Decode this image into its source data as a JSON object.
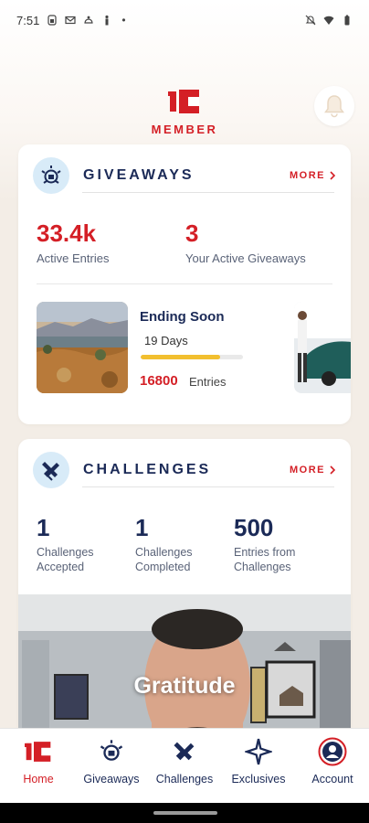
{
  "status_bar": {
    "time": "7:51",
    "dot": "•",
    "icons": [
      "sim-icon",
      "gmail-icon",
      "android-icon",
      "accessibility-icon",
      "mute-icon",
      "wifi-icon",
      "battery-icon"
    ]
  },
  "header": {
    "logo_text": "MEMBER",
    "bell_icon": "bell-icon"
  },
  "giveaways": {
    "title": "GIVEAWAYS",
    "more_label": "MORE",
    "active_entries_value": "33.4k",
    "active_entries_label": "Active Entries",
    "your_active_value": "3",
    "your_active_label": "Your Active Giveaways",
    "tile": {
      "title": "Ending Soon",
      "days": "19 Days",
      "progress": 0.78,
      "entries_value": "16800",
      "entries_label": "Entries"
    }
  },
  "challenges": {
    "title": "CHALLENGES",
    "more_label": "MORE",
    "stats": [
      {
        "value": "1",
        "label": "Challenges Accepted"
      },
      {
        "value": "1",
        "label": "Challenges Completed"
      },
      {
        "value": "500",
        "label": "Entries from Challenges"
      }
    ],
    "video_title": "Gratitude"
  },
  "bottom_nav": {
    "items": [
      {
        "label": "Home",
        "icon": "home-logo-icon",
        "active": true
      },
      {
        "label": "Giveaways",
        "icon": "giveaways-icon",
        "active": false
      },
      {
        "label": "Challenges",
        "icon": "challenges-icon",
        "active": false
      },
      {
        "label": "Exclusives",
        "icon": "exclusives-icon",
        "active": false
      },
      {
        "label": "Account",
        "icon": "account-icon",
        "active": false
      }
    ]
  },
  "colors": {
    "brand_red": "#d41f26",
    "navy": "#1b2a57",
    "accent_yellow": "#f2bf2f",
    "icon_bg": "#d8ebf8",
    "page_bg": "#f3ede6"
  }
}
